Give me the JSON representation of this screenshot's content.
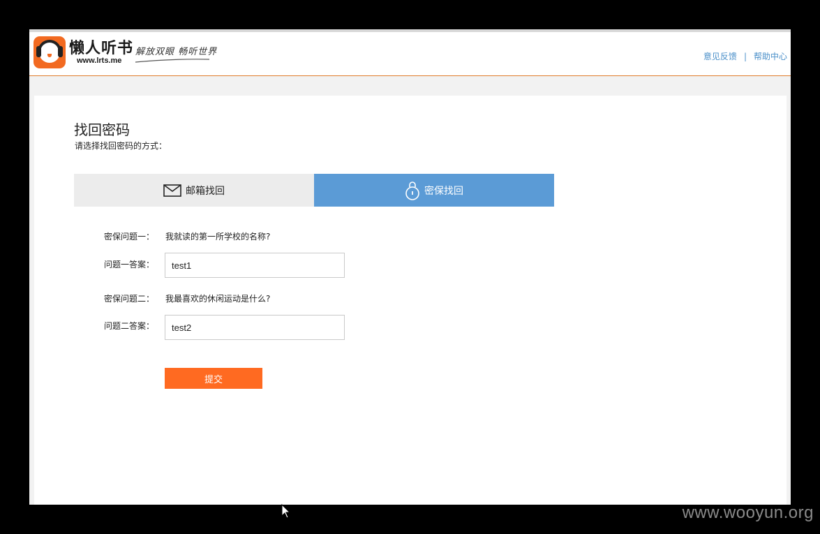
{
  "header": {
    "logo_title": "懒人听书",
    "logo_url": "www.lrts.me",
    "slogan": "解放双眼 畅听世界",
    "links": [
      {
        "label": "意见反馈"
      },
      {
        "label": "帮助中心"
      }
    ],
    "link_separator": "|"
  },
  "page": {
    "title": "找回密码",
    "subtitle": "请选择找回密码的方式："
  },
  "tabs": [
    {
      "label": "邮箱找回",
      "icon": "envelope-icon",
      "active": false
    },
    {
      "label": "密保找回",
      "icon": "lock-icon",
      "active": true
    }
  ],
  "form": {
    "q1_label": "密保问题一：",
    "q1_text": "我就读的第一所学校的名称?",
    "a1_label": "问题一答案：",
    "a1_value": "test1",
    "q2_label": "密保问题二：",
    "q2_text": "我最喜欢的休闲运动是什么?",
    "a2_label": "问题二答案：",
    "a2_value": "test2",
    "submit_label": "提交"
  },
  "watermark": "www.wooyun.org",
  "colors": {
    "accent_orange": "#ff6a21",
    "tab_active_blue": "#5b9bd6",
    "link_blue": "#4a8fc9"
  }
}
